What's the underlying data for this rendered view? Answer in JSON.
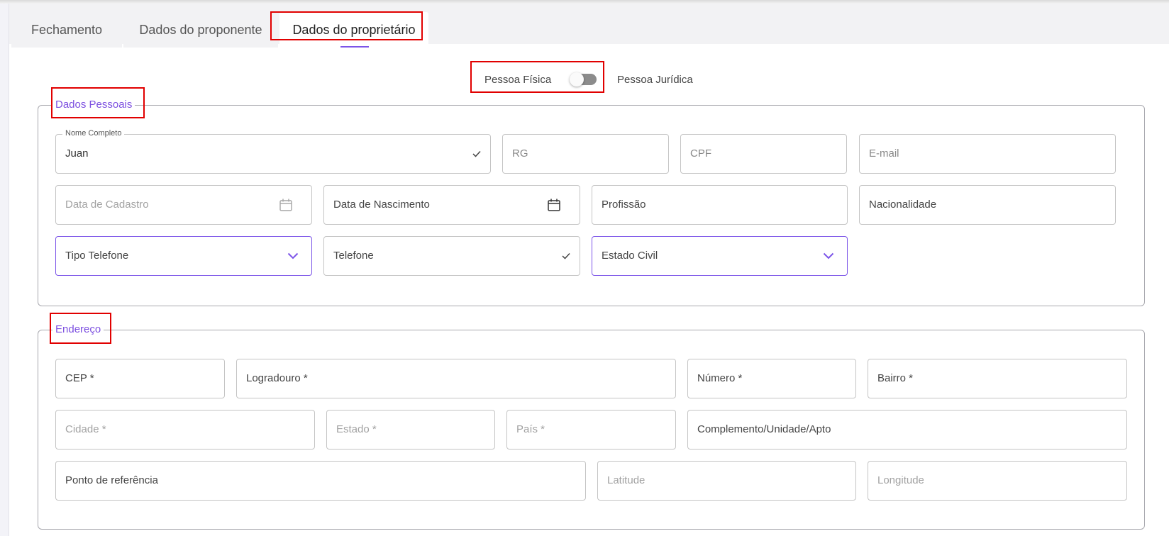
{
  "tabs": [
    {
      "label": "Fechamento"
    },
    {
      "label": "Dados do proponente"
    },
    {
      "label": "Dados do proprietário"
    }
  ],
  "person_toggle": {
    "left_label": "Pessoa Física",
    "right_label": "Pessoa Jurídica",
    "state": "off"
  },
  "personal": {
    "legend": "Dados Pessoais",
    "nome_completo": {
      "label": "Nome Completo",
      "value": "Juan"
    },
    "rg": "RG",
    "cpf": "CPF",
    "email": "E-mail",
    "data_cadastro": "Data de Cadastro",
    "data_nascimento": "Data de Nascimento",
    "profissao": "Profissão",
    "nacionalidade": "Nacionalidade",
    "tipo_telefone": "Tipo Telefone",
    "telefone": "Telefone",
    "estado_civil": "Estado Civil"
  },
  "address": {
    "legend": "Endereço",
    "cep": "CEP *",
    "logradouro": "Logradouro *",
    "numero": "Número *",
    "bairro": "Bairro *",
    "cidade": "Cidade *",
    "estado": "Estado *",
    "pais": "País *",
    "complemento": "Complemento/Unidade/Apto",
    "ponto_referencia": "Ponto de referência",
    "latitude": "Latitude",
    "longitude": "Longitude"
  },
  "colors": {
    "accent": "#7c55e8",
    "highlight": "#e10000"
  }
}
